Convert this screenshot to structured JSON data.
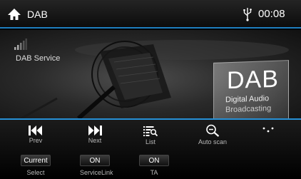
{
  "header": {
    "source": "DAB",
    "clock": "00:08",
    "accent_color": "#1e7fc0",
    "icons": {
      "home": "home-icon",
      "usb": "usb-icon"
    }
  },
  "main": {
    "service_name": "DAB Service",
    "signal_icon": "signal-strength-icon",
    "logo": {
      "big": "DAB",
      "line1": "Digital Audio",
      "line2": "Broadcasting"
    }
  },
  "controls": {
    "prev": {
      "label": "Prev",
      "icon": "skip-previous-icon"
    },
    "next": {
      "label": "Next",
      "icon": "skip-next-icon"
    },
    "list": {
      "label": "List",
      "icon": "list-search-icon"
    },
    "autoscan": {
      "label": "Auto scan",
      "icon": "scan-icon"
    },
    "more": {
      "label": "",
      "icon": "more-dots-icon"
    },
    "select": {
      "value": "Current",
      "label": "Select"
    },
    "servicelink": {
      "value": "ON",
      "label": "ServiceLink"
    },
    "ta": {
      "value": "ON",
      "label": "TA"
    }
  }
}
